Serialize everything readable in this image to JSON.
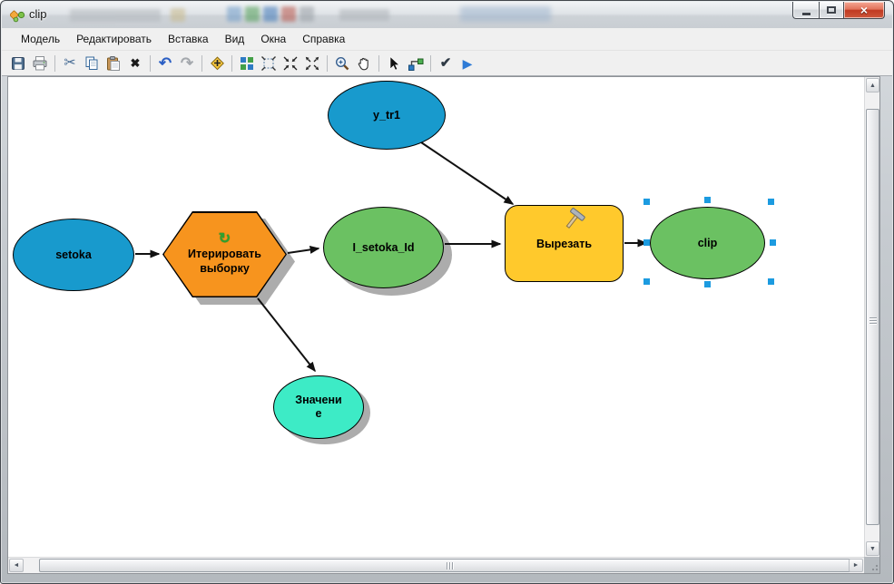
{
  "window": {
    "title": "clip"
  },
  "menu": {
    "items": [
      "Модель",
      "Редактировать",
      "Вставка",
      "Вид",
      "Окна",
      "Справка"
    ]
  },
  "toolbar": {
    "buttons": [
      "save",
      "print",
      "cut",
      "copy",
      "paste",
      "delete",
      "undo",
      "redo",
      "add-data",
      "auto-layout",
      "full-extent",
      "fixed-zoom-in",
      "fixed-zoom-out",
      "zoom-in",
      "pan",
      "select",
      "connect",
      "validate",
      "run"
    ]
  },
  "icons": {
    "cut": "✂",
    "delete": "✖",
    "undo": "↶",
    "redo": "↷",
    "validate": "✔",
    "run": "▶",
    "iterate": "↻",
    "close": "×",
    "scroll_up": "▲",
    "scroll_down": "▼",
    "scroll_left": "◄",
    "scroll_right": "►"
  },
  "diagram": {
    "nodes": [
      {
        "id": "setoka",
        "label": "setoka",
        "type": "input-data",
        "shape": "ellipse",
        "color": "#189ACD"
      },
      {
        "id": "iterate-selection",
        "label": "Итерировать выборку",
        "type": "iterator",
        "shape": "hexagon",
        "color": "#F7941E"
      },
      {
        "id": "y_tr1",
        "label": "y_tr1",
        "type": "input-data",
        "shape": "ellipse",
        "color": "#189ACD"
      },
      {
        "id": "i_setoka_id",
        "label": "I_setoka_Id",
        "type": "derived-data",
        "shape": "ellipse",
        "color": "#6BC162"
      },
      {
        "id": "clip-tool",
        "label": "Вырезать",
        "type": "tool",
        "shape": "rounded-rect",
        "color": "#FFC92C"
      },
      {
        "id": "clip-output",
        "label": "clip",
        "type": "derived-data",
        "shape": "ellipse",
        "color": "#6BC162",
        "selected": true
      },
      {
        "id": "value",
        "label": "Значение",
        "type": "output-value",
        "shape": "ellipse",
        "color": "#3DEBC6"
      }
    ],
    "connections": [
      {
        "from": "setoka",
        "to": "iterate-selection"
      },
      {
        "from": "iterate-selection",
        "to": "i_setoka_id"
      },
      {
        "from": "iterate-selection",
        "to": "value"
      },
      {
        "from": "y_tr1",
        "to": "clip-tool"
      },
      {
        "from": "i_setoka_id",
        "to": "clip-tool"
      },
      {
        "from": "clip-tool",
        "to": "clip-output"
      }
    ]
  }
}
